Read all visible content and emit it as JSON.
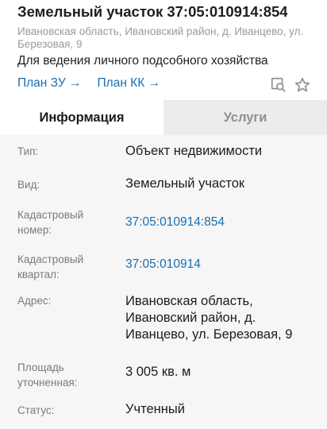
{
  "header": {
    "title": "Земельный участок 37:05:010914:854",
    "address": "Ивановская область, Ивановский район, д. Иванцево, ул. Березовая, 9",
    "purpose": "Для ведения личного подсобного хозяйства",
    "links": {
      "plan_zu": "План ЗУ →",
      "plan_kk": "План КК →"
    },
    "icons": [
      "map-search-icon",
      "star-icon"
    ]
  },
  "tabs": [
    {
      "label": "Информация",
      "active": true
    },
    {
      "label": "Услуги",
      "active": false
    }
  ],
  "details": {
    "type": {
      "label": "Тип:",
      "value": "Объект недвижимости"
    },
    "kind": {
      "label": "Вид:",
      "value": "Земельный участок"
    },
    "cadastral_number": {
      "label": "Кадастровый номер:",
      "value": "37:05:010914:854"
    },
    "cadastral_quarter": {
      "label": "Кадастровый квартал:",
      "value": "37:05:010914"
    },
    "address": {
      "label": "Адрес:",
      "value": "Ивановская область, Ивановский район, д. Иванцево, ул. Березовая, 9"
    },
    "area": {
      "label": "Площадь уточненная:",
      "value": "3 005 кв. м"
    },
    "status": {
      "label": "Статус:",
      "value": "Учтенный"
    }
  },
  "colors": {
    "link": "#1a6fb0",
    "panel_bg": "#f6f6f6",
    "inactive_tab_bg": "#ececec",
    "label": "#7a7a7a"
  }
}
